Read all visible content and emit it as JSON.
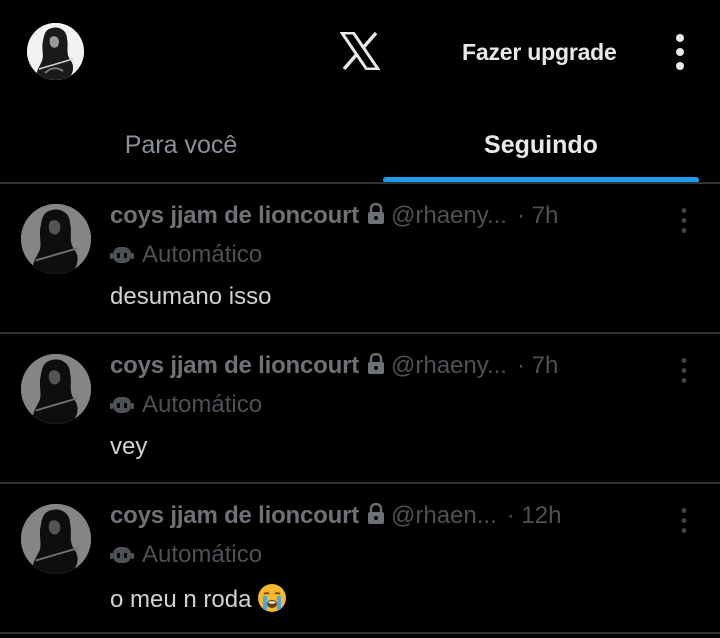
{
  "header": {
    "upgrade_label": "Fazer upgrade"
  },
  "tabs": [
    {
      "label": "Para você",
      "active": false
    },
    {
      "label": "Seguindo",
      "active": true
    }
  ],
  "colors": {
    "accent": "#1d9bf0",
    "background": "#000000",
    "divider": "#2f3336"
  },
  "icons": [
    "profile-avatar",
    "x-logo-icon",
    "more-vert-icon",
    "lock-icon",
    "bot-icon",
    "crying-face-emoji"
  ],
  "posts": [
    {
      "name": "coys jjam de lioncourt",
      "handle": "@rhaeny...",
      "time": "· 7h",
      "label": "Automático",
      "text": "desumano isso"
    },
    {
      "name": "coys jjam de lioncourt",
      "handle": "@rhaeny...",
      "time": "· 7h",
      "label": "Automático",
      "text": "vey"
    },
    {
      "name": "coys jjam de lioncourt",
      "handle": "@rhaen...",
      "time": "· 12h",
      "label": "Automático",
      "text": "o meu n roda"
    }
  ]
}
